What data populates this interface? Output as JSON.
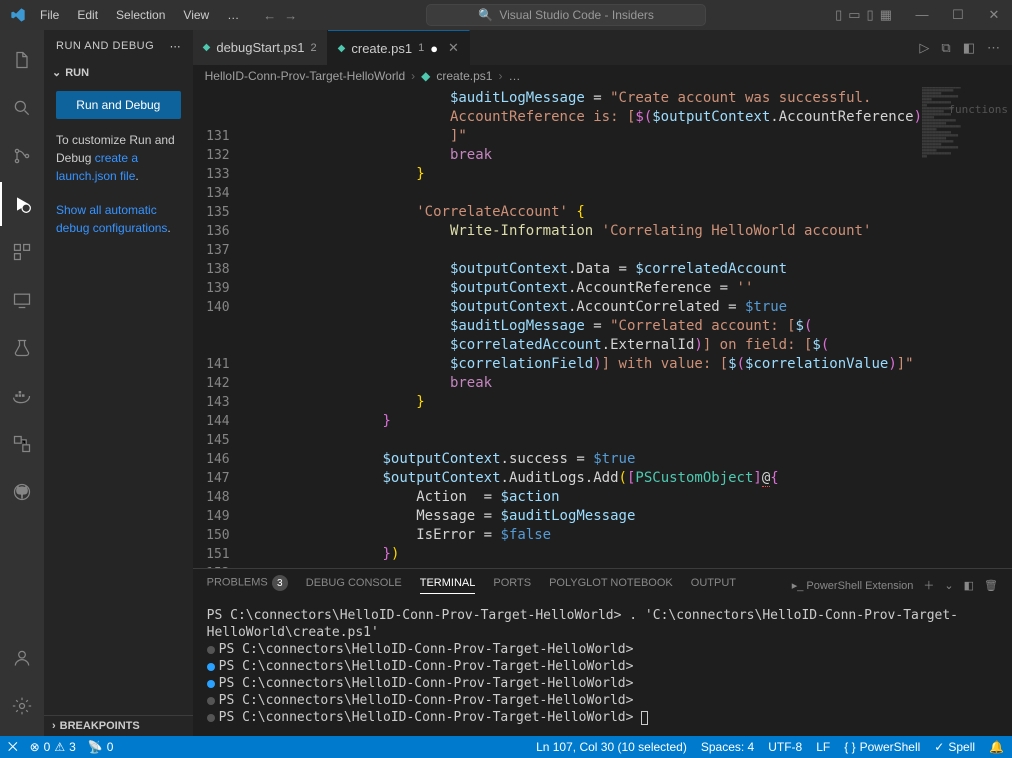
{
  "titlebar": {
    "menu": [
      "File",
      "Edit",
      "Selection",
      "View",
      "…"
    ],
    "search_placeholder": "Visual Studio Code - Insiders"
  },
  "sidebar": {
    "title": "RUN AND DEBUG",
    "section": "RUN",
    "run_button": "Run and Debug",
    "customize_pre": "To customize Run and Debug ",
    "customize_link": "create a launch.json file",
    "customize_post": ".",
    "show_link": "Show all automatic debug configurations",
    "show_post": ".",
    "breakpoints": "BREAKPOINTS"
  },
  "tabs": [
    {
      "name": "debugStart.ps1",
      "badge": "2",
      "active": false
    },
    {
      "name": "create.ps1",
      "badge": "1",
      "active": true,
      "modified": true
    }
  ],
  "breadcrumb": {
    "folder": "HelloID-Conn-Prov-Target-HelloWorld",
    "file": "create.ps1",
    "tail": "…"
  },
  "code_lines": [
    {
      "no": 131,
      "indent": 24,
      "segs": [
        {
          "t": "$auditLogMessage",
          "c": "tok-var"
        },
        {
          "t": " = ",
          "c": "tok-op"
        },
        {
          "t": "\"Create account was successful. AccountReference is: [",
          "c": "tok-str"
        },
        {
          "t": "$(",
          "c": "tok-punc2"
        },
        {
          "t": "$outputContext",
          "c": "tok-var"
        },
        {
          "t": ".AccountReference",
          "c": "tok-op"
        },
        {
          "t": ")",
          "c": "tok-punc2"
        },
        {
          "t": "]\"",
          "c": "tok-str"
        }
      ]
    },
    {
      "no": 132,
      "indent": 24,
      "segs": [
        {
          "t": "break",
          "c": "tok-kw"
        }
      ]
    },
    {
      "no": 133,
      "indent": 20,
      "segs": [
        {
          "t": "}",
          "c": "tok-punc"
        }
      ]
    },
    {
      "no": 134,
      "indent": 0,
      "segs": []
    },
    {
      "no": 135,
      "indent": 20,
      "segs": [
        {
          "t": "'CorrelateAccount'",
          "c": "tok-str"
        },
        {
          "t": " {",
          "c": "tok-punc"
        }
      ]
    },
    {
      "no": 136,
      "indent": 24,
      "segs": [
        {
          "t": "Write-Information",
          "c": "tok-cmd"
        },
        {
          "t": " ",
          "c": ""
        },
        {
          "t": "'Correlating HelloWorld account'",
          "c": "tok-str"
        }
      ]
    },
    {
      "no": 137,
      "indent": 0,
      "segs": []
    },
    {
      "no": 138,
      "indent": 24,
      "segs": [
        {
          "t": "$outputContext",
          "c": "tok-var"
        },
        {
          "t": ".Data = ",
          "c": "tok-op"
        },
        {
          "t": "$correlatedAccount",
          "c": "tok-var"
        }
      ]
    },
    {
      "no": 139,
      "indent": 24,
      "segs": [
        {
          "t": "$outputContext",
          "c": "tok-var"
        },
        {
          "t": ".AccountReference = ",
          "c": "tok-op"
        },
        {
          "t": "''",
          "c": "tok-str"
        }
      ]
    },
    {
      "no": 140,
      "indent": 24,
      "segs": [
        {
          "t": "$outputContext",
          "c": "tok-var"
        },
        {
          "t": ".AccountCorrelated = ",
          "c": "tok-op"
        },
        {
          "t": "$true",
          "c": "tok-const"
        }
      ]
    },
    {
      "no": 141,
      "indent": 24,
      "segs": [
        {
          "t": "$auditLogMessage",
          "c": "tok-var"
        },
        {
          "t": " = ",
          "c": "tok-op"
        },
        {
          "t": "\"Correlated account: [",
          "c": "tok-str"
        },
        {
          "t": "$",
          "c": "tok-var"
        },
        {
          "t": "(",
          "c": "tok-punc2"
        },
        {
          "t": "$correlatedAccount",
          "c": "tok-var"
        },
        {
          "t": ".ExternalId",
          "c": "tok-op"
        },
        {
          "t": ")",
          "c": "tok-punc2"
        },
        {
          "t": "] on field: [",
          "c": "tok-str"
        },
        {
          "t": "$",
          "c": "tok-var"
        },
        {
          "t": "(",
          "c": "tok-punc2"
        },
        {
          "t": "$correlationField",
          "c": "tok-var"
        },
        {
          "t": ")",
          "c": "tok-punc2"
        },
        {
          "t": "] with value: [",
          "c": "tok-str"
        },
        {
          "t": "$",
          "c": "tok-var"
        },
        {
          "t": "(",
          "c": "tok-punc2"
        },
        {
          "t": "$correlationValue",
          "c": "tok-var"
        },
        {
          "t": ")",
          "c": "tok-punc2"
        },
        {
          "t": "]\"",
          "c": "tok-str"
        }
      ]
    },
    {
      "no": 142,
      "indent": 24,
      "segs": [
        {
          "t": "break",
          "c": "tok-kw"
        }
      ]
    },
    {
      "no": 143,
      "indent": 20,
      "segs": [
        {
          "t": "}",
          "c": "tok-punc"
        }
      ]
    },
    {
      "no": 144,
      "indent": 16,
      "segs": [
        {
          "t": "}",
          "c": "tok-punc2"
        }
      ]
    },
    {
      "no": 145,
      "indent": 0,
      "segs": []
    },
    {
      "no": 146,
      "indent": 16,
      "segs": [
        {
          "t": "$outputContext",
          "c": "tok-var"
        },
        {
          "t": ".success = ",
          "c": "tok-op"
        },
        {
          "t": "$true",
          "c": "tok-const"
        }
      ]
    },
    {
      "no": 147,
      "indent": 16,
      "segs": [
        {
          "t": "$outputContext",
          "c": "tok-var"
        },
        {
          "t": ".AuditLogs.Add",
          "c": "tok-op"
        },
        {
          "t": "(",
          "c": "tok-punc"
        },
        {
          "t": "[",
          "c": "tok-punc2"
        },
        {
          "t": "PSCustomObject",
          "c": "tok-type"
        },
        {
          "t": "]",
          "c": "tok-punc2"
        },
        {
          "t": "@",
          "c": "tok-err"
        },
        {
          "t": "{",
          "c": "tok-punc2"
        }
      ]
    },
    {
      "no": 148,
      "indent": 20,
      "segs": [
        {
          "t": "Action  = ",
          "c": "tok-op"
        },
        {
          "t": "$action",
          "c": "tok-var"
        }
      ]
    },
    {
      "no": 149,
      "indent": 20,
      "segs": [
        {
          "t": "Message = ",
          "c": "tok-op"
        },
        {
          "t": "$auditLogMessage",
          "c": "tok-var"
        }
      ]
    },
    {
      "no": 150,
      "indent": 20,
      "segs": [
        {
          "t": "IsError = ",
          "c": "tok-op"
        },
        {
          "t": "$false",
          "c": "tok-const"
        }
      ]
    },
    {
      "no": 151,
      "indent": 16,
      "segs": [
        {
          "t": "}",
          "c": "tok-punc2"
        },
        {
          "t": ")",
          "c": "tok-punc"
        }
      ]
    },
    {
      "no": 152,
      "indent": 0,
      "segs": []
    }
  ],
  "minimap_label": "functions",
  "panel": {
    "tabs": [
      "PROBLEMS",
      "DEBUG CONSOLE",
      "TERMINAL",
      "PORTS",
      "POLYGLOT NOTEBOOK",
      "OUTPUT"
    ],
    "problems_badge": "3",
    "active": "TERMINAL",
    "profile": "PowerShell Extension",
    "terminal": [
      "PS C:\\connectors\\HelloID-Conn-Prov-Target-HelloWorld> . 'C:\\connectors\\HelloID-Conn-Prov-Target-HelloWorld\\create.ps1'",
      "PS C:\\connectors\\HelloID-Conn-Prov-Target-HelloWorld>",
      "PS C:\\connectors\\HelloID-Conn-Prov-Target-HelloWorld>",
      "PS C:\\connectors\\HelloID-Conn-Prov-Target-HelloWorld>",
      "PS C:\\connectors\\HelloID-Conn-Prov-Target-HelloWorld>",
      "PS C:\\connectors\\HelloID-Conn-Prov-Target-HelloWorld>"
    ]
  },
  "statusbar": {
    "errors": "0",
    "warnings": "3",
    "ports": "0",
    "cursor": "Ln 107, Col 30 (10 selected)",
    "spaces": "Spaces: 4",
    "encoding": "UTF-8",
    "eol": "LF",
    "lang": "PowerShell",
    "spell": "Spell"
  }
}
